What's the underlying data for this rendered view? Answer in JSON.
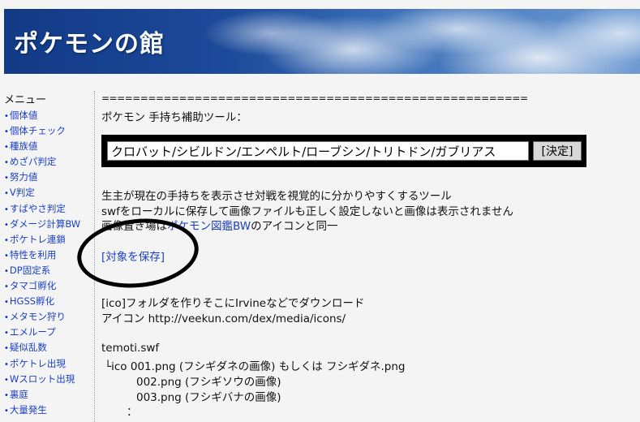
{
  "header": {
    "title": "ポケモンの館"
  },
  "sidebar": {
    "title": "メニュー",
    "items": [
      {
        "label": "個体値"
      },
      {
        "label": "個体チェック"
      },
      {
        "label": "種族値"
      },
      {
        "label": "めざパ判定"
      },
      {
        "label": "努力値"
      },
      {
        "label": "V判定"
      },
      {
        "label": "すばやさ判定"
      },
      {
        "label": "ダメージ計算BW"
      },
      {
        "label": "ポケトレ連鎖"
      },
      {
        "label": "特性を利用"
      },
      {
        "label": "DP固定系"
      },
      {
        "label": "タマゴ孵化"
      },
      {
        "label": "HGSS孵化"
      },
      {
        "label": "メタモン狩り"
      },
      {
        "label": "エメループ"
      },
      {
        "label": "疑似乱数"
      },
      {
        "label": "ポケトレ出現"
      },
      {
        "label": "Wスロット出現"
      },
      {
        "label": "裏庭"
      },
      {
        "label": "大量発生"
      }
    ]
  },
  "main": {
    "rule": "=======================================================",
    "tool_heading": "ポケモン 手持ち補助ツール：",
    "party_input_value": "クロバット/シビルドン/エンペルト/ローブシン/トリトドン/ガブリアス",
    "decide_button": "[決定]",
    "desc1": "生主が現在の手持ちを表示させ対戦を視覚的に分かりやすくするツール",
    "desc2": "swfをローカルに保存して画像ファイルも正しく設定しないと画像は表示されません",
    "desc3_prefix": "画像置き場は",
    "desc3_link": "ポケモン図鑑BW",
    "desc3_suffix": "のアイコンと同一",
    "save_link": "[対象を保存]",
    "folder_note": "[ico]フォルダを作りそこにIrvineなどでダウンロード",
    "icon_url": "アイコン http://veekun.com/dex/media/icons/",
    "temoti": "temoti.swf",
    "file1": "└ico 001.png (フシギダネの画像) もしくは フシギダネ.png",
    "file2": "002.png (フシギソウの画像)",
    "file3": "003.png (フシギバナの画像)",
    "ellipsis": "："
  },
  "colors": {
    "link": "#1a3fc7",
    "banner": "#1c4a9a",
    "background": "#f4f4f4"
  }
}
